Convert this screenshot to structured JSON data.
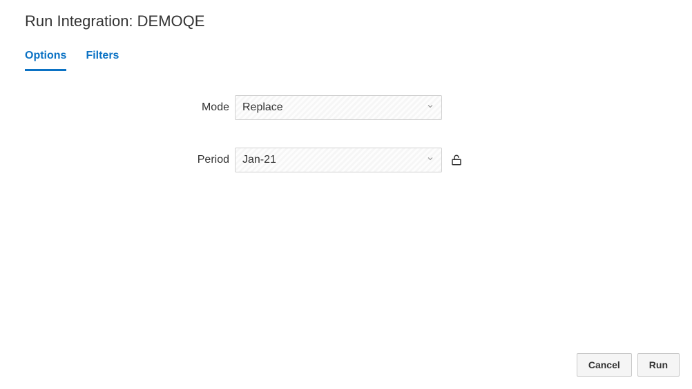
{
  "header": {
    "title": "Run Integration: DEMOQE"
  },
  "tabs": {
    "options": "Options",
    "filters": "Filters"
  },
  "form": {
    "mode": {
      "label": "Mode",
      "value": "Replace"
    },
    "period": {
      "label": "Period",
      "value": "Jan-21"
    }
  },
  "footer": {
    "cancel": "Cancel",
    "run": "Run"
  }
}
